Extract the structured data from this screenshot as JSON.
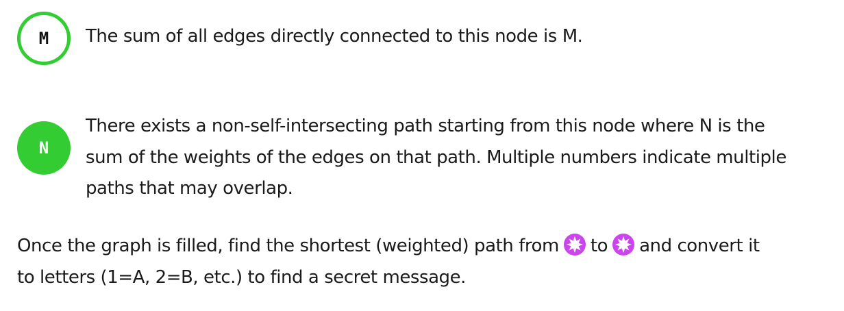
{
  "rules": [
    {
      "node_label": "M",
      "text_lines": [
        "The sum of all edges directly connected to this node is M."
      ]
    },
    {
      "node_label": "N",
      "text_lines": [
        "There exists a non-self-intersecting path starting from this node where N is the",
        "sum of the weights of the edges on that path. Multiple numbers indicate multiple",
        "paths that may overlap."
      ]
    }
  ],
  "instruction": {
    "line1_before": "Once the graph is filled, find the shortest (weighted) path from",
    "line1_middle": "to",
    "line1_after": "and convert it",
    "line2": "to letters (1=A, 2=B, etc.) to find a secret message."
  },
  "colors": {
    "node_green": "#33cc33",
    "star_purple": "#cc44ee",
    "text": "#1a1a1a"
  },
  "icons": {
    "start_marker": "purple-star-node-icon",
    "end_marker": "purple-star-node-icon"
  }
}
